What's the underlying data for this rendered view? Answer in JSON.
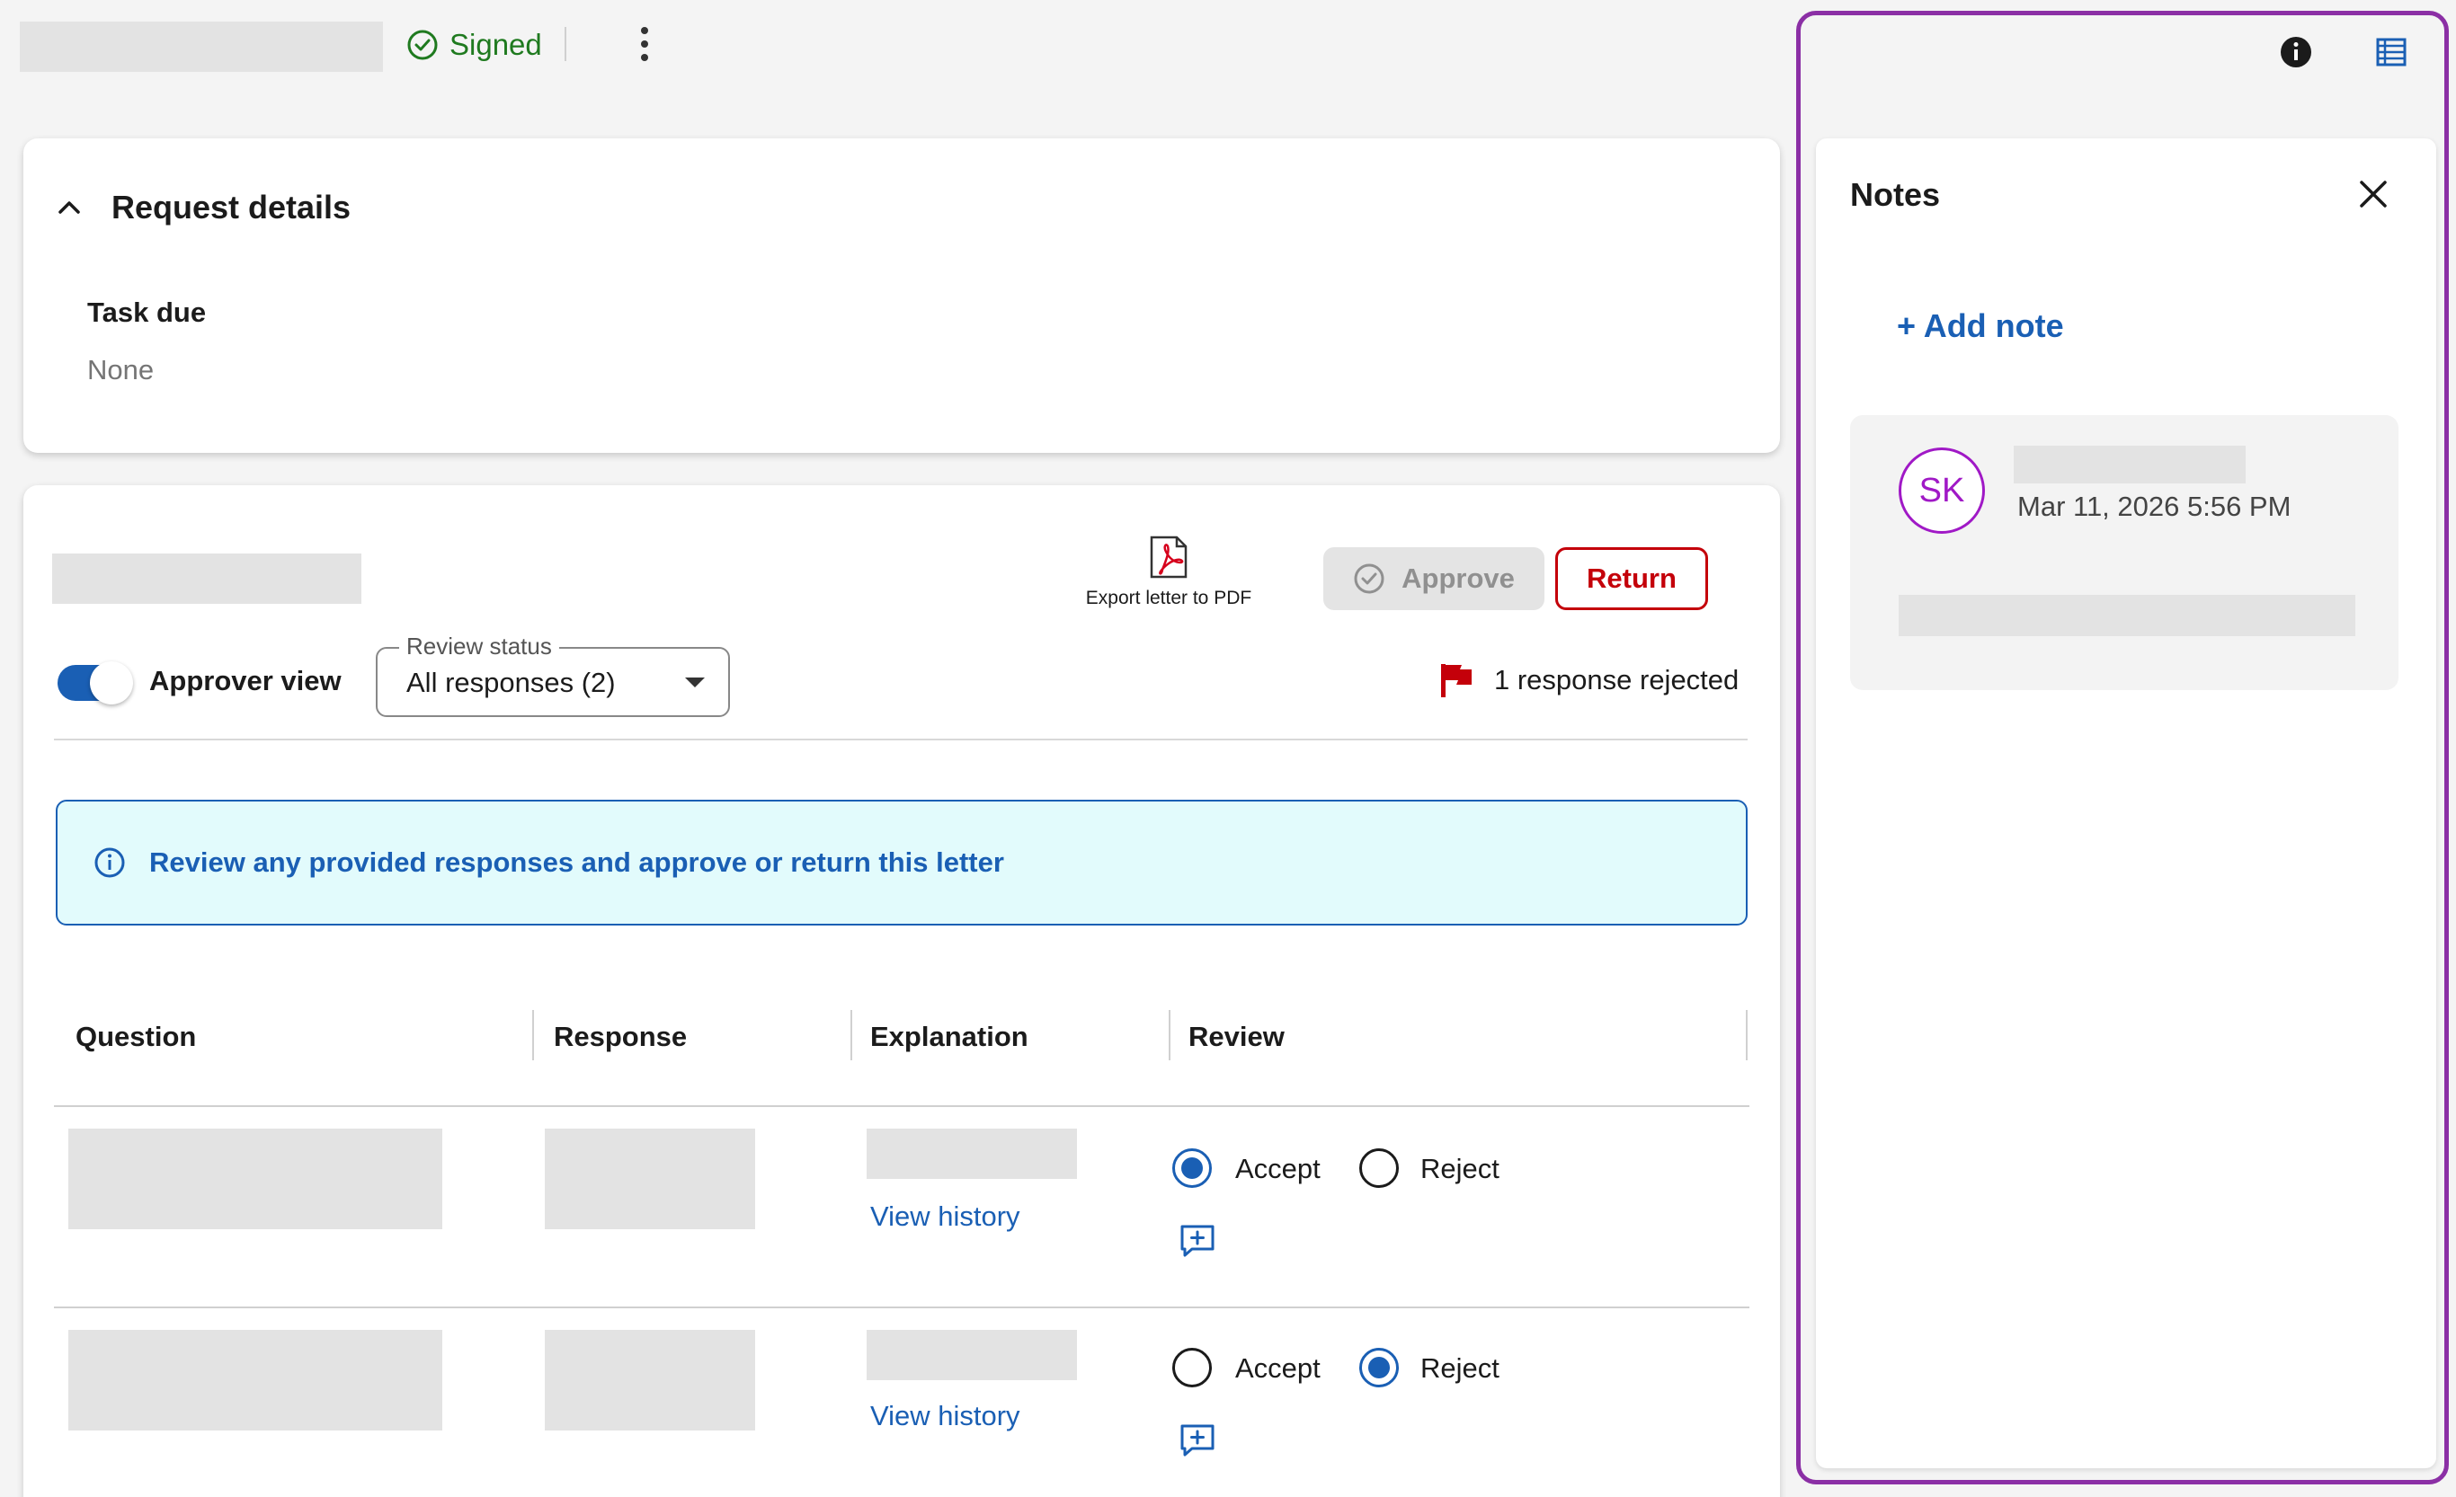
{
  "topbar": {
    "status_label": "Signed"
  },
  "request_details": {
    "title": "Request details",
    "task_due_label": "Task due",
    "task_due_value": "None"
  },
  "letter": {
    "export_label": "Export letter to PDF",
    "approve_label": "Approve",
    "return_label": "Return",
    "approver_view_label": "Approver view",
    "approver_view_on": true,
    "review_status_label": "Review status",
    "review_status_value": "All responses (2)",
    "rejected_summary": "1 response rejected",
    "info_banner": "Review any provided responses and approve or return this letter"
  },
  "table": {
    "columns": [
      "Question",
      "Response",
      "Explanation",
      "Review"
    ],
    "rows": [
      {
        "history_link": "View history",
        "accept_label": "Accept",
        "reject_label": "Reject",
        "selected": "accept"
      },
      {
        "history_link": "View history",
        "accept_label": "Accept",
        "reject_label": "Reject",
        "selected": "reject"
      }
    ]
  },
  "notes": {
    "title": "Notes",
    "add_note_label": "+ Add note",
    "items": [
      {
        "initials": "SK",
        "date": "Mar 11, 2026 5:56 PM"
      }
    ]
  },
  "colors": {
    "accent_blue": "#1a5fb4",
    "signed_green": "#1f7a1f",
    "return_red": "#c4000a",
    "notes_outline_purple": "#8b2fa5",
    "avatar_purple": "#a019c6",
    "info_bg": "#e2fbfc"
  },
  "icons": {
    "signed": "check-circle-icon",
    "menu": "kebab-menu-icon",
    "collapse": "chevron-up-icon",
    "export": "pdf-icon",
    "approve": "check-circle-icon",
    "rejected": "flag-icon",
    "info": "info-icon",
    "comment": "add-comment-icon",
    "panel_info": "info-icon",
    "panel_table": "table-icon",
    "close": "close-icon"
  }
}
